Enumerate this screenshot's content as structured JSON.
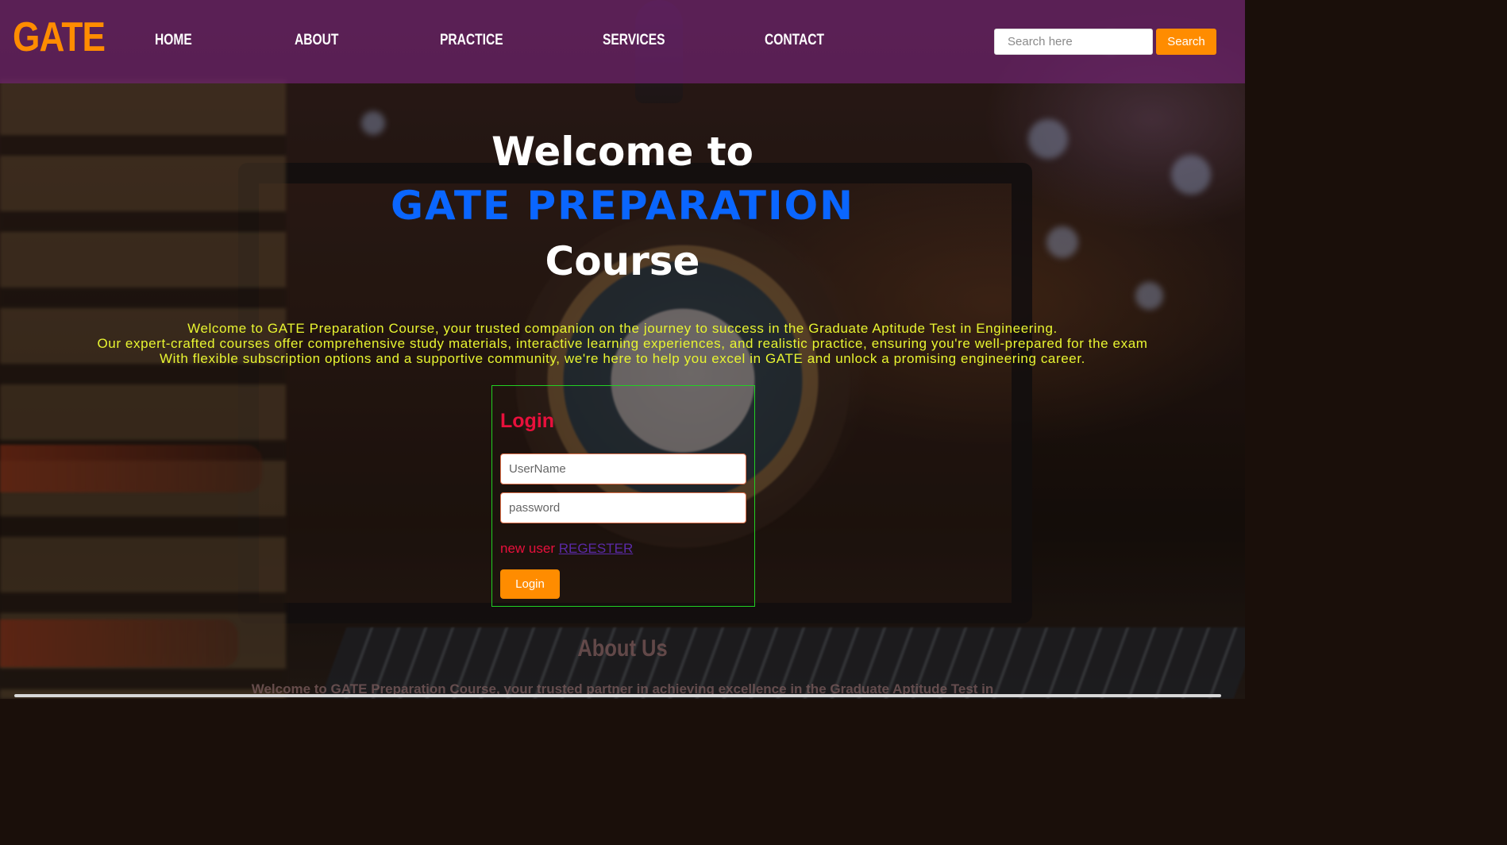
{
  "header": {
    "logo": "GATE",
    "nav": [
      {
        "label": "HOME"
      },
      {
        "label": "ABOUT"
      },
      {
        "label": "PRACTICE"
      },
      {
        "label": "SERVICES"
      },
      {
        "label": "CONTACT"
      }
    ],
    "search": {
      "placeholder": "Search here",
      "value": "",
      "button_label": "Search"
    }
  },
  "hero": {
    "line1": "Welcome to",
    "line2": "GATE PREPARATION",
    "line3": "Course"
  },
  "intro": {
    "paragraphs": [
      "Welcome to GATE Preparation Course, your trusted companion on the journey to success in the Graduate Aptitude Test in Engineering.",
      "Our expert-crafted courses offer comprehensive study materials, interactive learning experiences, and realistic practice, ensuring you're well-prepared for the exam",
      "With flexible subscription options and a supportive community, we're here to help you excel in GATE and unlock a promising engineering career."
    ]
  },
  "login": {
    "title": "Login",
    "username_placeholder": "UserName",
    "password_placeholder": "password",
    "new_user_text": "new user",
    "register_link": "REGESTER",
    "button_label": "Login"
  },
  "about": {
    "title": "About Us",
    "text": "Welcome to GATE Preparation Course, your trusted partner in achieving excellence in the Graduate Aptitude Test in"
  },
  "colors": {
    "accent": "#ff8c00",
    "header_bg": "#6e236e",
    "hero_highlight": "#0a66ff",
    "intro_text": "#e8f531",
    "login_title": "#e8103c",
    "login_border": "#22d022",
    "register_link": "#5b2aa8"
  }
}
